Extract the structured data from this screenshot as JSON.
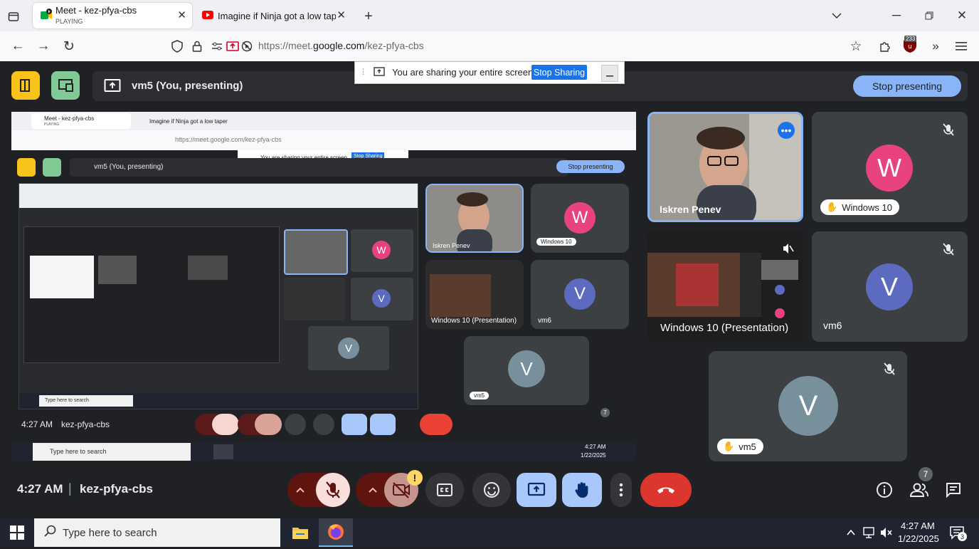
{
  "browser": {
    "tabs": [
      {
        "title": "Meet - kez-pfya-cbs",
        "subtitle": "PLAYING",
        "active": true
      },
      {
        "title": "Imagine if Ninja got a low taper",
        "active": false
      }
    ],
    "url_prefix": "https://meet.",
    "url_domain": "google.com",
    "url_path": "/kez-pfya-cbs",
    "extension_badge": "233"
  },
  "meet": {
    "presenting_label": "vm5 (You, presenting)",
    "share_banner_text": "You are sharing your entire screen.",
    "stop_sharing_label": "Stop Sharing",
    "stop_presenting_label": "Stop presenting",
    "meeting_time": "4:27 AM",
    "meeting_code": "kez-pfya-cbs",
    "people_count": "7",
    "participants": [
      {
        "name": "Iskren Penev"
      },
      {
        "name": "Windows 10",
        "initial": "W",
        "color": "#e8437e"
      },
      {
        "name": "Windows 10 (Presentation)"
      },
      {
        "name": "vm6",
        "initial": "V",
        "color": "#5c6bc0"
      },
      {
        "name": "vm5",
        "initial": "V",
        "color": "#78909c"
      }
    ]
  },
  "nested": {
    "time": "4:27 AM",
    "code": "kez-pfya-cbs",
    "search_placeholder": "Type here to search",
    "clock_time": "4:27 AM",
    "clock_date": "1/22/2025",
    "people_count": "7"
  },
  "taskbar": {
    "search_placeholder": "Type here to search",
    "time": "4:27 AM",
    "date": "1/22/2025",
    "notification_count": "3"
  },
  "colors": {
    "yellow_btn": "#f9c31a",
    "green_btn": "#81c995",
    "end_call": "#ea4335",
    "accent": "#8ab4f8"
  }
}
